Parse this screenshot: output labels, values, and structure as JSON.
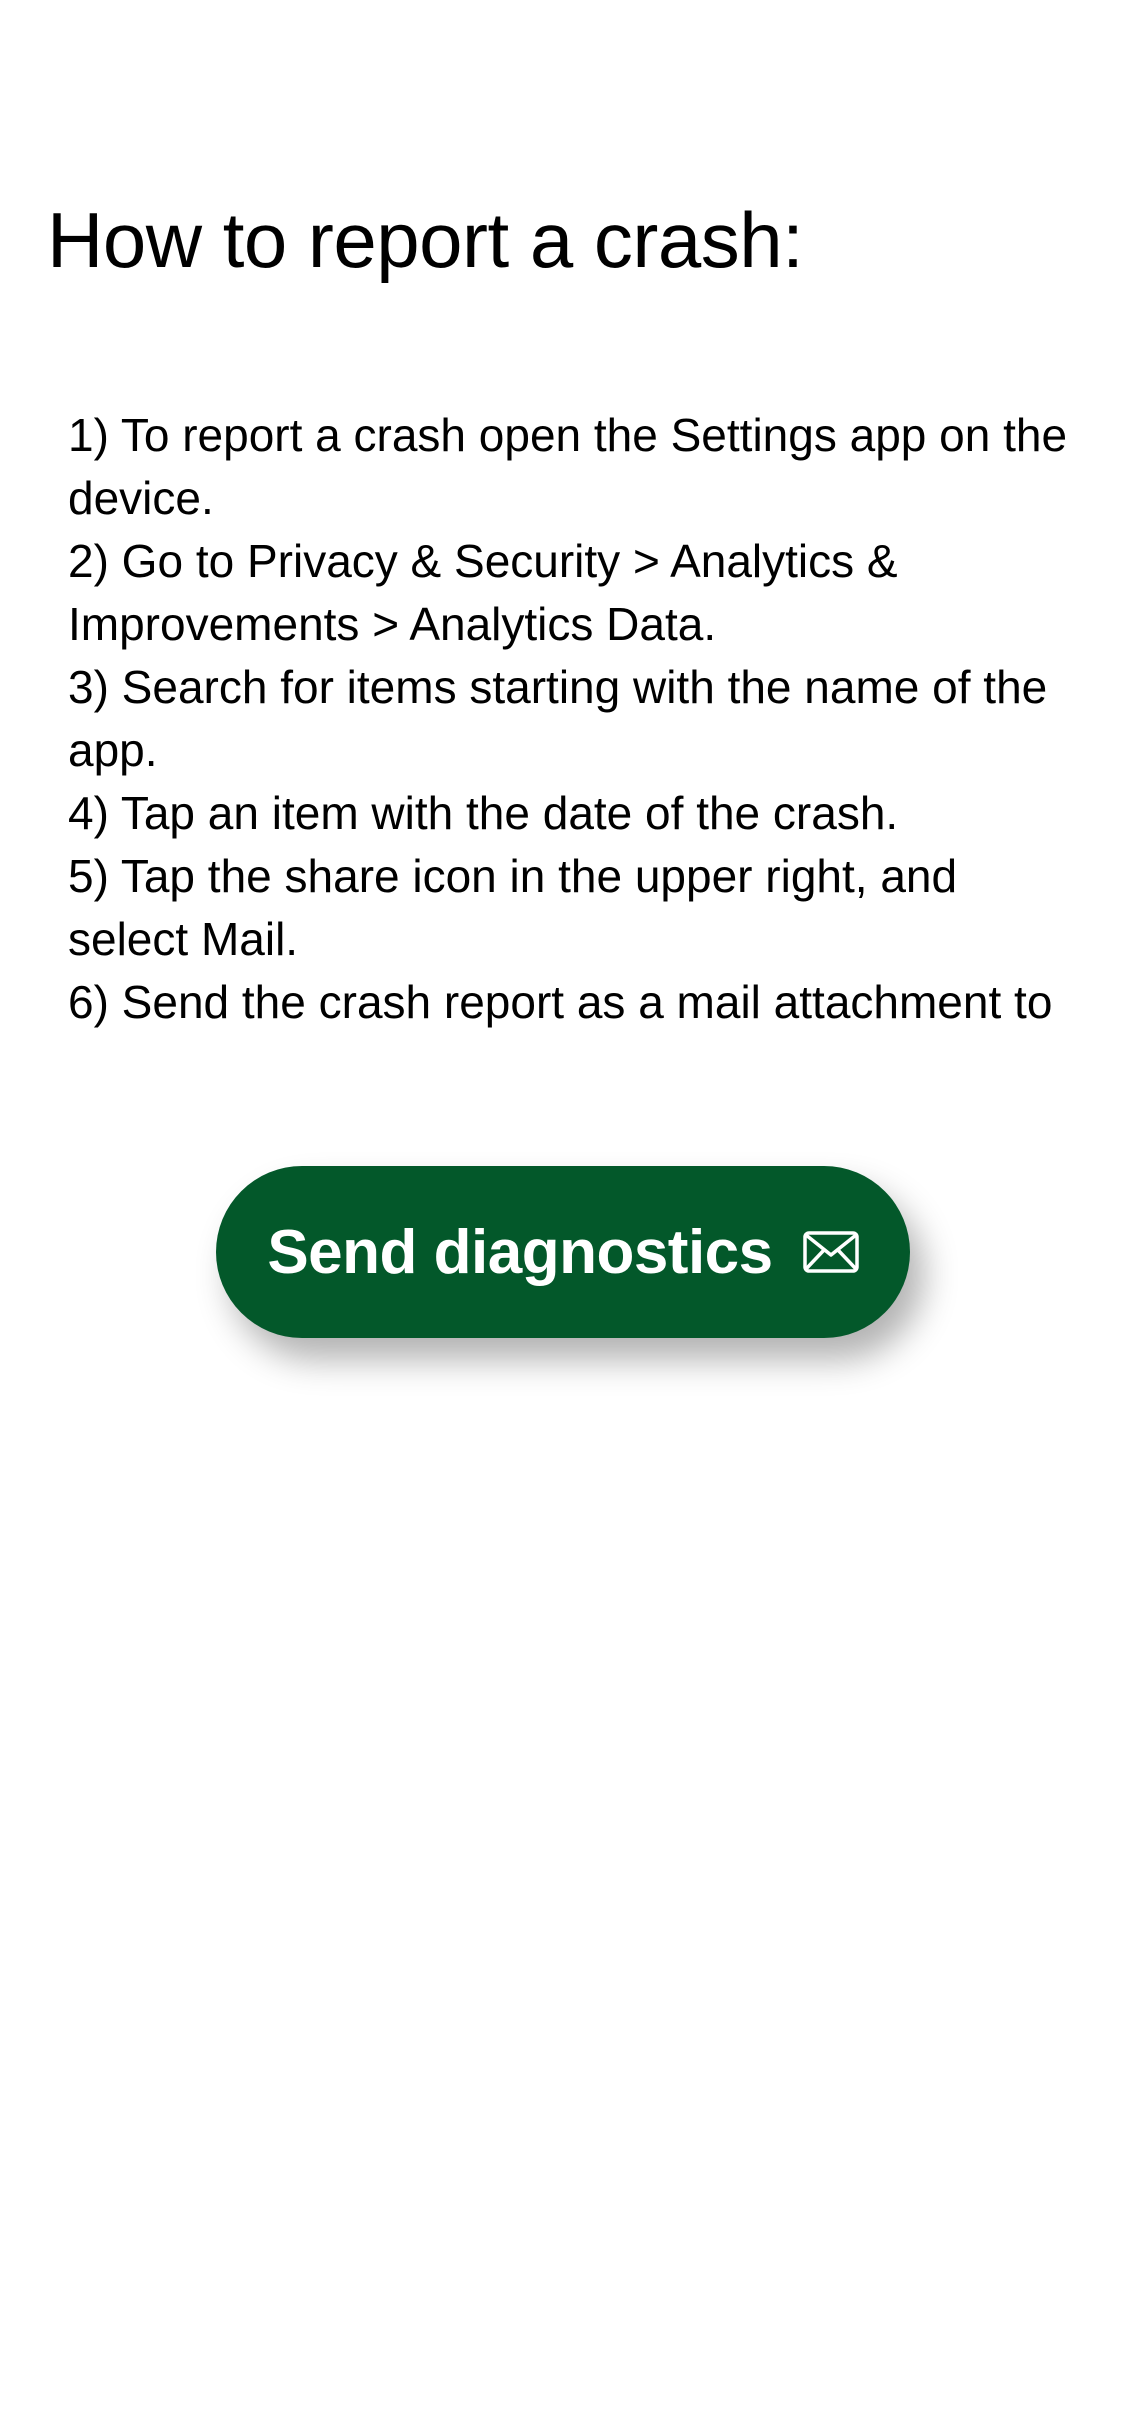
{
  "page": {
    "title": "How to report a crash:"
  },
  "steps": [
    "1) To report a crash open the Settings app on the device.",
    "2) Go to Privacy & Security > Analytics & Improvements > Analytics Data.",
    "3) Search for items starting with the name of the app.",
    "4) Tap an item with the date of the crash.",
    "5) Tap the share icon in the upper right, and select Mail.",
    "6) Send the crash report as a mail attachment to"
  ],
  "send_button": {
    "label": "Send diagnostics",
    "icon": "envelope-icon"
  },
  "colors": {
    "accent": "#03582a",
    "text": "#000000",
    "background": "#ffffff"
  }
}
